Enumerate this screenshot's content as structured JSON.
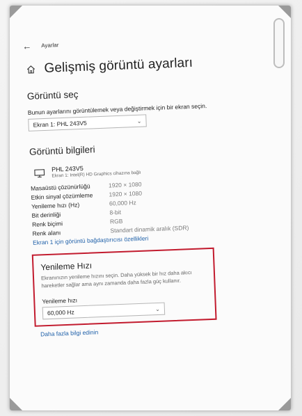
{
  "header": {
    "back_label": "Ayarlar",
    "title": "Gelişmiş görüntü ayarları"
  },
  "select_display": {
    "title": "Görüntü seç",
    "description": "Bunun ayarlarını görüntülemek veya değiştirmek için bir ekran seçin.",
    "selected": "Ekran 1: PHL 243V5"
  },
  "display_info": {
    "title": "Görüntü bilgileri",
    "monitor_name": "PHL 243V5",
    "monitor_sub": "Ekran 1: Intel(R) HD Graphics cihazına bağlı",
    "rows": [
      {
        "key": "Masaüstü çözünürlüğü",
        "value": "1920 × 1080"
      },
      {
        "key": "Etkin sinyal çözümleme",
        "value": "1920 × 1080"
      },
      {
        "key": "Yenileme hızı (Hz)",
        "value": "60,000 Hz"
      },
      {
        "key": "Bit derinliği",
        "value": "8-bit"
      },
      {
        "key": "Renk biçimi",
        "value": "RGB"
      },
      {
        "key": "Renk alanı",
        "value": "Standart dinamik aralık (SDR)"
      }
    ],
    "adapter_link": "Ekran 1 için görüntü bağdaştırıcısı özellikleri"
  },
  "refresh_rate": {
    "title": "Yenileme Hızı",
    "description": "Ekranınızın yenileme hızını seçin. Daha yüksek bir hız daha akıcı hareketler sağlar ama aynı zamanda daha fazla güç kullanır.",
    "label": "Yenileme hızı",
    "selected": "60,000 Hz",
    "more_link": "Daha fazla bilgi edinin"
  },
  "colors": {
    "highlight_border": "#c21b2e",
    "link": "#1d5fa8"
  },
  "icons": {
    "back": "arrow-left-icon",
    "home": "home-icon",
    "monitor": "monitor-icon",
    "dropdown": "chevron-down-icon"
  }
}
